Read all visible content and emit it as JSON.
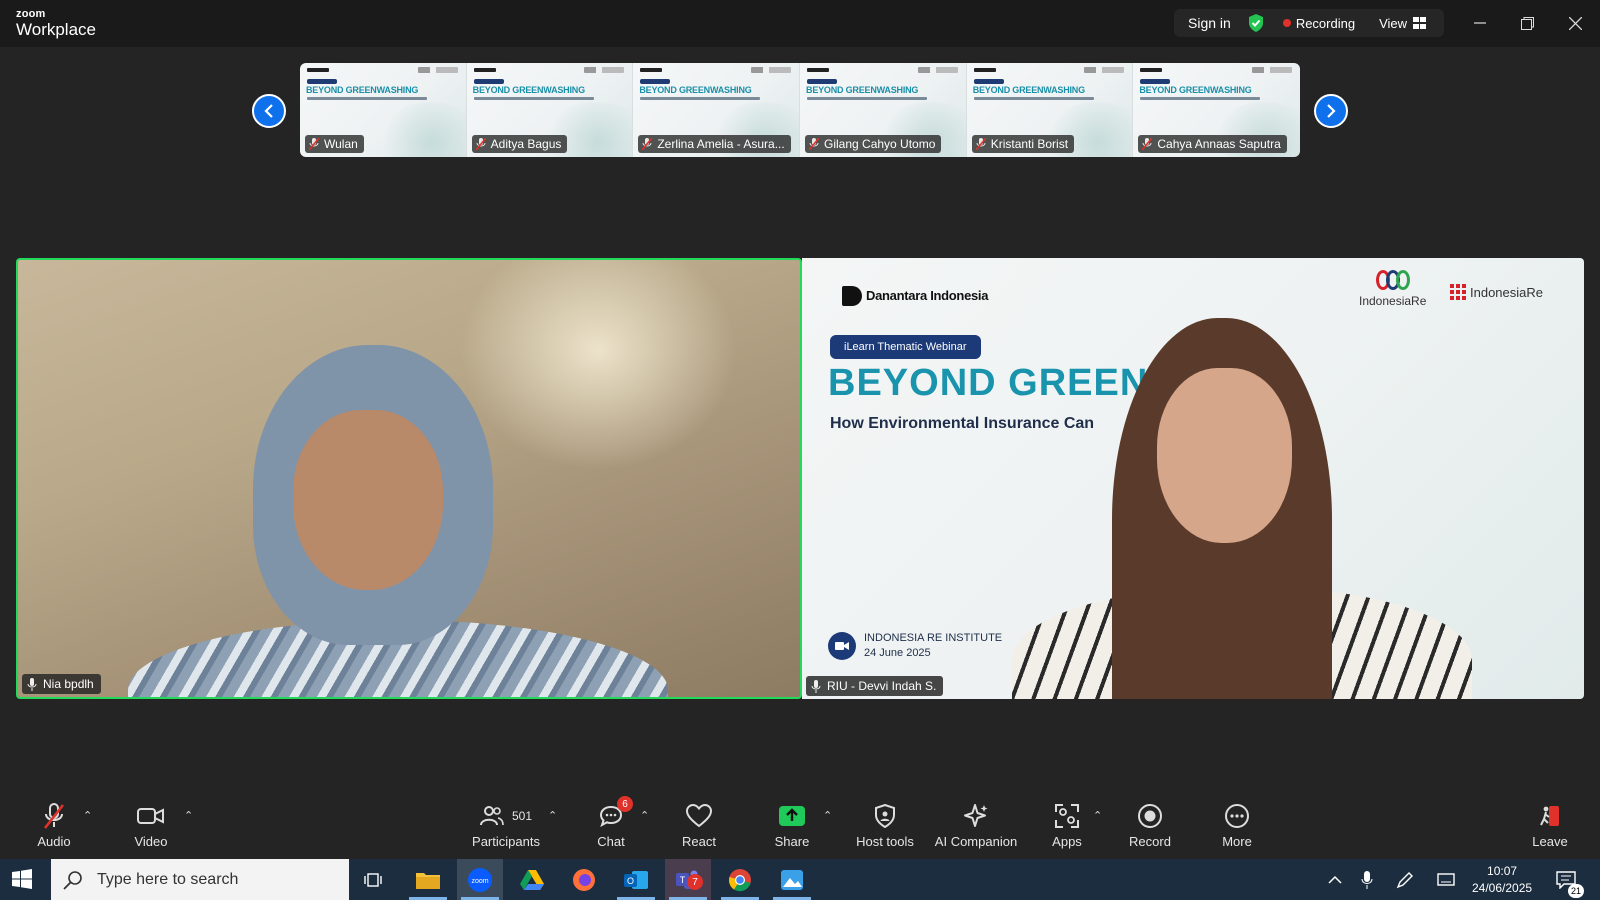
{
  "app": {
    "logo_top": "zoom",
    "logo_bottom": "Workplace"
  },
  "titlebar": {
    "sign_in": "Sign in",
    "recording": "Recording",
    "view": "View"
  },
  "thumbnails": [
    {
      "name": "Wulan",
      "slide_title": "BEYOND GREENWASHING"
    },
    {
      "name": "Aditya Bagus",
      "slide_title": "BEYOND GREENWASHING"
    },
    {
      "name": "Zerlina Amelia - Asura...",
      "slide_title": "BEYOND GREENWASHING"
    },
    {
      "name": "Gilang Cahyo Utomo",
      "slide_title": "BEYOND GREENWASHING"
    },
    {
      "name": "Kristanti Borist",
      "slide_title": "BEYOND GREENWASHING"
    },
    {
      "name": "Cahya Annaas Saputra",
      "slide_title": "BEYOND GREENWASHING"
    }
  ],
  "main_videos": {
    "left": {
      "name": "Nia bpdlh"
    },
    "right": {
      "name": "RIU - Devvi Indah S.",
      "slide": {
        "logo_danantara": "Danantara Indonesia",
        "logo_indonesia_re": "IndonesiaRe",
        "logo_iri": "IndonesiaRe",
        "chip": "iLearn Thematic Webinar",
        "title": "BEYOND GREEN",
        "subtitle": "How Environmental Insurance Can",
        "footer_org": "INDONESIA RE INSTITUTE",
        "footer_date": "24 June 2025"
      }
    }
  },
  "toolbar": {
    "audio": "Audio",
    "video": "Video",
    "participants": "Participants",
    "participants_count": "501",
    "chat": "Chat",
    "chat_badge": "6",
    "react": "React",
    "share": "Share",
    "host_tools": "Host tools",
    "ai_companion": "AI Companion",
    "apps": "Apps",
    "record": "Record",
    "more": "More",
    "leave": "Leave"
  },
  "taskbar": {
    "search_placeholder": "Type here to search",
    "time": "10:07",
    "date": "24/06/2025",
    "teams_badge": "7",
    "notifications": "21"
  },
  "colors": {
    "active_speaker": "#23d959",
    "accent_blue": "#0e71eb",
    "recording_red": "#e0312b",
    "share_green": "#1fc95a",
    "slide_title": "#1a93ad"
  }
}
